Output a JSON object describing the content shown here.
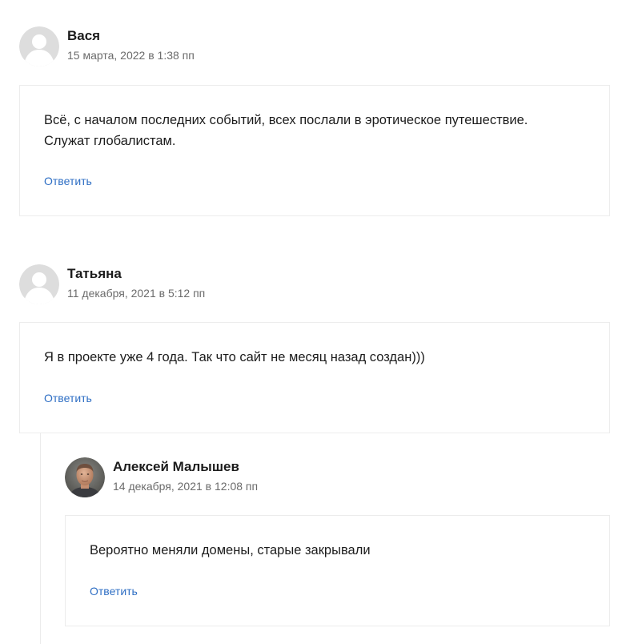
{
  "comments": [
    {
      "author": "Вася",
      "date": "15 марта, 2022 в 1:38 пп",
      "text_lines": [
        "Всё, с началом последних событий, всех послали в эротическое путешествие.",
        "Служат глобалистам."
      ],
      "reply_label": "Ответить",
      "avatar_icon": "default-avatar-icon"
    },
    {
      "author": "Татьяна",
      "date": "11 декабря, 2021 в 5:12 пп",
      "text_lines": [
        "Я в проекте уже 4 года. Так что сайт не месяц назад создан)))"
      ],
      "reply_label": "Ответить",
      "avatar_icon": "default-avatar-icon"
    },
    {
      "author": "Алексей Малышев",
      "date": "14 декабря, 2021 в 12:08 пп",
      "text_lines": [
        "Вероятно меняли домены, старые закрывали"
      ],
      "reply_label": "Ответить",
      "avatar_icon": "user-photo-avatar"
    }
  ],
  "colors": {
    "link": "#2f6fc4",
    "border": "#ececec",
    "date": "#6b6b6b",
    "avatar_bg": "#dddddd"
  }
}
